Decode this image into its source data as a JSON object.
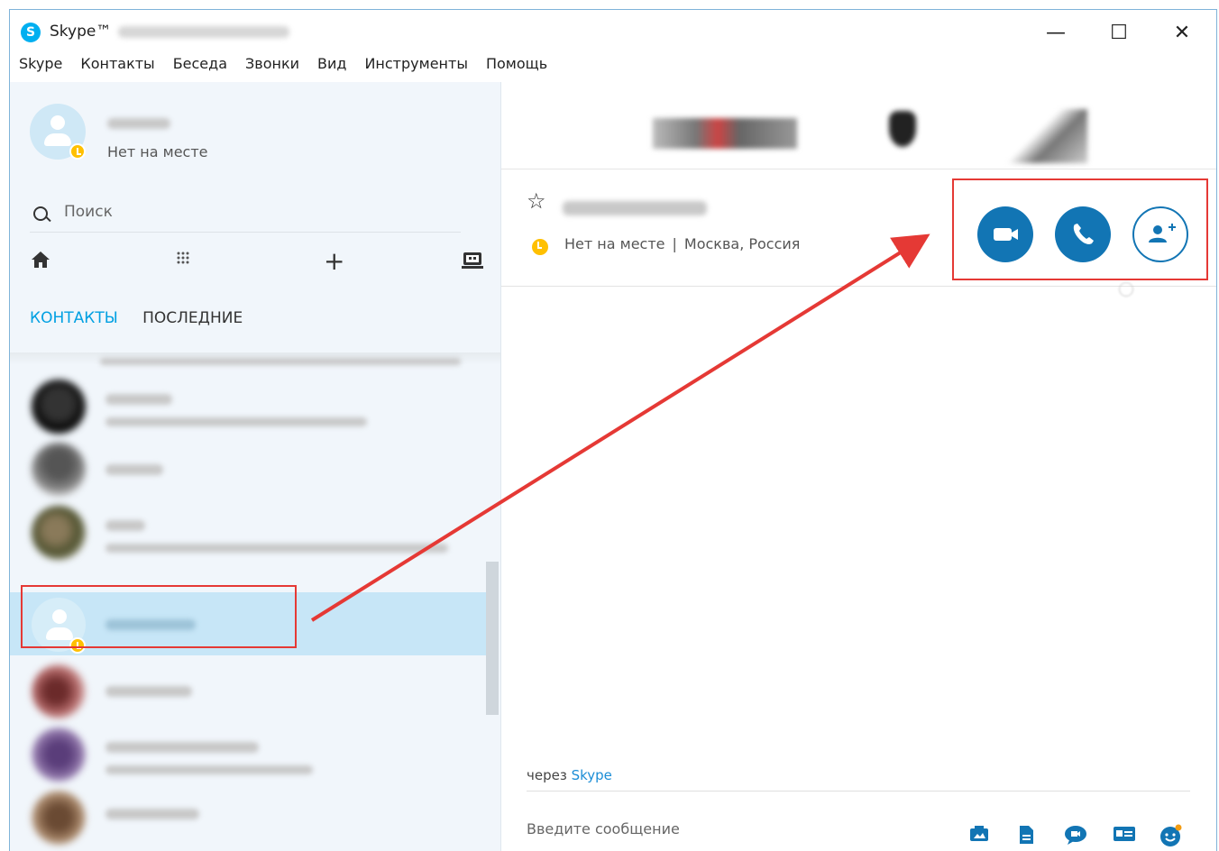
{
  "window": {
    "app_logo": "S",
    "app_title": "Skype™",
    "controls": {
      "minimize": "—",
      "maximize": "☐",
      "close": "✕"
    }
  },
  "menu": [
    "Skype",
    "Контакты",
    "Беседа",
    "Звонки",
    "Вид",
    "Инструменты",
    "Помощь"
  ],
  "profile": {
    "status": "Нет на месте",
    "status_color": "#ffc000"
  },
  "search": {
    "placeholder": "Поиск"
  },
  "toolbar": {
    "home": "home-icon",
    "dialpad": "dialpad-icon",
    "add": "+",
    "bot": "bot-icon"
  },
  "tabs": {
    "contacts": "КОНТАКТЫ",
    "recent": "ПОСЛЕДНИЕ"
  },
  "conversation": {
    "status_text": "Нет на месте",
    "separator": "|",
    "location": "Москва, Россия",
    "via_prefix": "через",
    "via_link": "Skype",
    "message_placeholder": "Введите сообщение"
  },
  "call_actions": [
    "video-call-icon",
    "audio-call-icon",
    "add-people-icon"
  ],
  "message_tools": [
    "image-share-icon",
    "file-send-icon",
    "video-message-icon",
    "contact-card-icon",
    "emoticon-icon"
  ],
  "colors": {
    "accent": "#00a0e2",
    "call_button": "#1275b4",
    "selected_row": "#c7e6f7",
    "highlight_red": "#e53935"
  }
}
